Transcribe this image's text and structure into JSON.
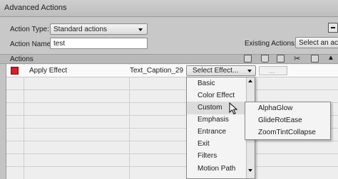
{
  "window": {
    "title": "Advanced Actions"
  },
  "form": {
    "action_type_label": "Action Type:",
    "action_type_value": "Standard actions",
    "action_name_label": "Action Name:",
    "action_name_value": "test",
    "existing_actions_label": "Existing Actions:",
    "existing_actions_value": "Select an acti"
  },
  "actions": {
    "header": "Actions",
    "rows": [
      {
        "color": "#d4202a",
        "action": "Apply Effect",
        "target": "Text_Caption_29",
        "effect": "Select Effect..."
      }
    ]
  },
  "effect_menu": {
    "items": [
      {
        "label": "Basic",
        "has_submenu": true
      },
      {
        "label": "Color Effect",
        "has_submenu": true
      },
      {
        "label": "Custom",
        "has_submenu": true,
        "highlighted": true
      },
      {
        "label": "Emphasis",
        "has_submenu": true
      },
      {
        "label": "Entrance",
        "has_submenu": true
      },
      {
        "label": "Exit",
        "has_submenu": true
      },
      {
        "label": "Filters",
        "has_submenu": true
      },
      {
        "label": "Motion Path",
        "has_submenu": true
      }
    ]
  },
  "custom_submenu": {
    "items": [
      {
        "label": "AlphaGlow"
      },
      {
        "label": "GlideRotEase"
      },
      {
        "label": "ZoomTintCollapse"
      }
    ]
  },
  "icons": {
    "toolbar": [
      "add-icon",
      "delete-icon",
      "copy-icon",
      "cut-icon",
      "paste-icon",
      "move-up-icon",
      "move-down-icon"
    ]
  }
}
